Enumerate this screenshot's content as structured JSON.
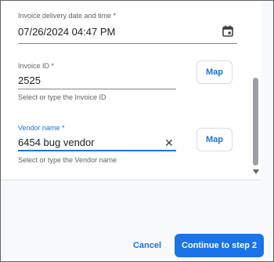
{
  "form": {
    "delivery": {
      "label": "Invoice delivery date and time *",
      "value": "07/26/2024 04:47 PM"
    },
    "invoice_id": {
      "label": "Invoice ID *",
      "value": "2525",
      "helper": "Select or type the Invoice ID",
      "map_label": "Map"
    },
    "vendor": {
      "label": "Vendor name *",
      "value": "6454 bug vendor",
      "helper": "Select or type the Vendor name",
      "map_label": "Map"
    }
  },
  "footer": {
    "cancel_label": "Cancel",
    "continue_label": "Continue to step 2"
  },
  "icons": {
    "calendar": "calendar-icon",
    "clear": "close-icon",
    "scroll_down": "chevron-down-icon"
  },
  "colors": {
    "accent": "#1a73e8",
    "muted_text": "#5f6368"
  }
}
